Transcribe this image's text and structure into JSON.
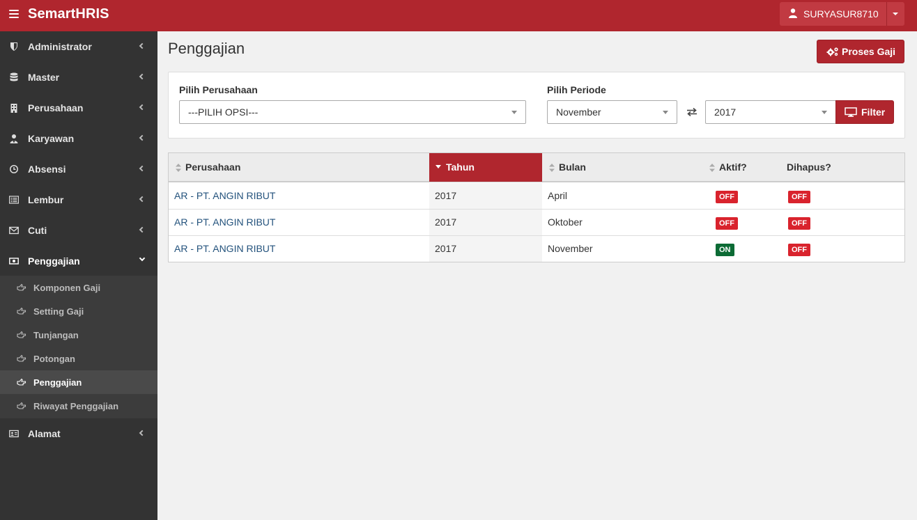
{
  "app": {
    "brand": "SemartHRIS",
    "user": "SURYASUR8710"
  },
  "colors": {
    "accent": "#b0262e",
    "sidebar": "#333333",
    "on": "#0c6b35",
    "off": "#d9232d"
  },
  "sidebar": {
    "items": [
      {
        "label": "Administrator",
        "icon": "shield-icon"
      },
      {
        "label": "Master",
        "icon": "database-icon"
      },
      {
        "label": "Perusahaan",
        "icon": "building-icon"
      },
      {
        "label": "Karyawan",
        "icon": "user-tie-icon"
      },
      {
        "label": "Absensi",
        "icon": "clock-icon"
      },
      {
        "label": "Lembur",
        "icon": "list-icon"
      },
      {
        "label": "Cuti",
        "icon": "envelope-icon"
      },
      {
        "label": "Penggajian",
        "icon": "money-icon"
      },
      {
        "label": "Alamat",
        "icon": "address-card-icon"
      }
    ],
    "submenu": [
      {
        "label": "Komponen Gaji"
      },
      {
        "label": "Setting Gaji"
      },
      {
        "label": "Tunjangan"
      },
      {
        "label": "Potongan"
      },
      {
        "label": "Penggajian"
      },
      {
        "label": "Riwayat Penggajian"
      }
    ]
  },
  "page": {
    "title": "Penggajian",
    "proses_button": "Proses Gaji"
  },
  "filter": {
    "company_label": "Pilih Perusahaan",
    "company_value": "---PILIH OPSI---",
    "period_label": "Pilih Periode",
    "month_value": "November",
    "year_value": "2017",
    "filter_button": "Filter"
  },
  "table": {
    "headers": [
      "Perusahaan",
      "Tahun",
      "Bulan",
      "Aktif?",
      "Dihapus?"
    ],
    "rows": [
      {
        "perusahaan": "AR - PT. ANGIN RIBUT",
        "tahun": "2017",
        "bulan": "April",
        "aktif": "OFF",
        "dihapus": "OFF"
      },
      {
        "perusahaan": "AR - PT. ANGIN RIBUT",
        "tahun": "2017",
        "bulan": "Oktober",
        "aktif": "OFF",
        "dihapus": "OFF"
      },
      {
        "perusahaan": "AR - PT. ANGIN RIBUT",
        "tahun": "2017",
        "bulan": "November",
        "aktif": "ON",
        "dihapus": "OFF"
      }
    ]
  }
}
